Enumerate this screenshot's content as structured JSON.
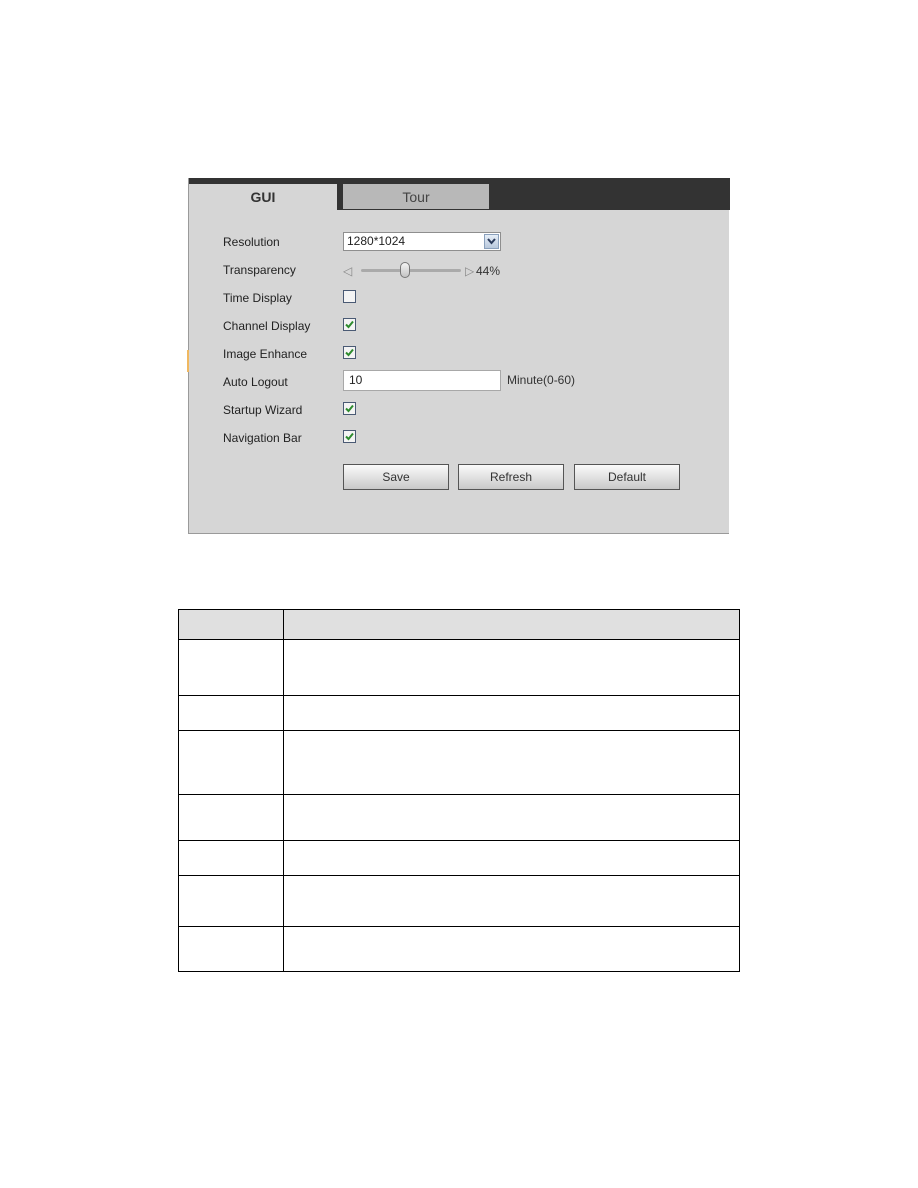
{
  "tabs": [
    {
      "label": "GUI",
      "active": true
    },
    {
      "label": "Tour",
      "active": false
    }
  ],
  "form": {
    "resolution": {
      "label": "Resolution",
      "value": "1280*1024"
    },
    "transparency": {
      "label": "Transparency",
      "value_percent": 44,
      "value_text": "44%"
    },
    "time_display": {
      "label": "Time Display",
      "checked": false
    },
    "channel_display": {
      "label": "Channel Display",
      "checked": true
    },
    "image_enhance": {
      "label": "Image Enhance",
      "checked": true
    },
    "auto_logout": {
      "label": "Auto Logout",
      "value": "10",
      "unit": "Minute(0-60)"
    },
    "startup_wizard": {
      "label": "Startup Wizard",
      "checked": true
    },
    "navigation_bar": {
      "label": "Navigation Bar",
      "checked": true
    }
  },
  "buttons": {
    "save": "Save",
    "refresh": "Refresh",
    "default": "Default"
  },
  "table": {
    "headers": [
      "",
      ""
    ],
    "rows": [
      [
        "",
        ""
      ],
      [
        "",
        ""
      ],
      [
        "",
        ""
      ],
      [
        "",
        ""
      ],
      [
        "",
        ""
      ],
      [
        "",
        ""
      ],
      [
        "",
        ""
      ]
    ]
  },
  "colors": {
    "tabbar": "#333333",
    "panel": "#d6d6d6",
    "check": "#2e8b2e"
  }
}
